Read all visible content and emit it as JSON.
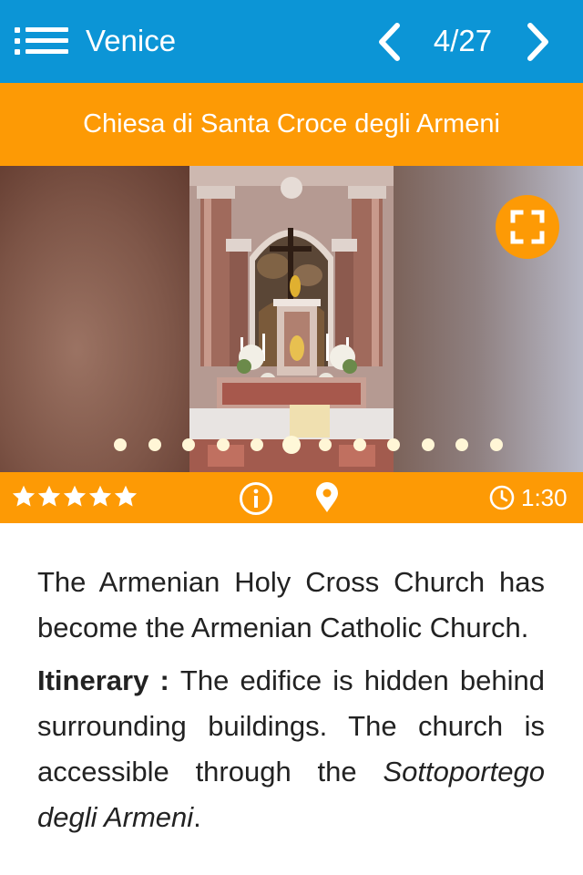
{
  "header": {
    "title": "Venice",
    "page_counter": "4/27"
  },
  "place": {
    "name": "Chiesa di Santa Croce degli Armeni"
  },
  "gallery": {
    "image_count": 12,
    "active_index": 5
  },
  "info": {
    "rating": 5,
    "duration": "1:30"
  },
  "description": {
    "intro": "The Armenian Holy Cross Church has become the Armenian Catholic Church.",
    "itinerary_label": "Itinerary",
    "itinerary_separator": " : ",
    "itinerary_text": "The edifice is hidden behind surrounding buildings. The church is accessible through the",
    "itinerary_place": "Sottoportego degli Armeni",
    "itinerary_end": "."
  },
  "colors": {
    "header_blue": "#0c95d6",
    "accent_orange": "#fd9a05",
    "text": "#222222"
  },
  "icons": [
    "menu-icon",
    "chevron-left-icon",
    "chevron-right-icon",
    "fullscreen-icon",
    "star-icon",
    "info-icon",
    "map-pin-icon",
    "clock-icon"
  ]
}
